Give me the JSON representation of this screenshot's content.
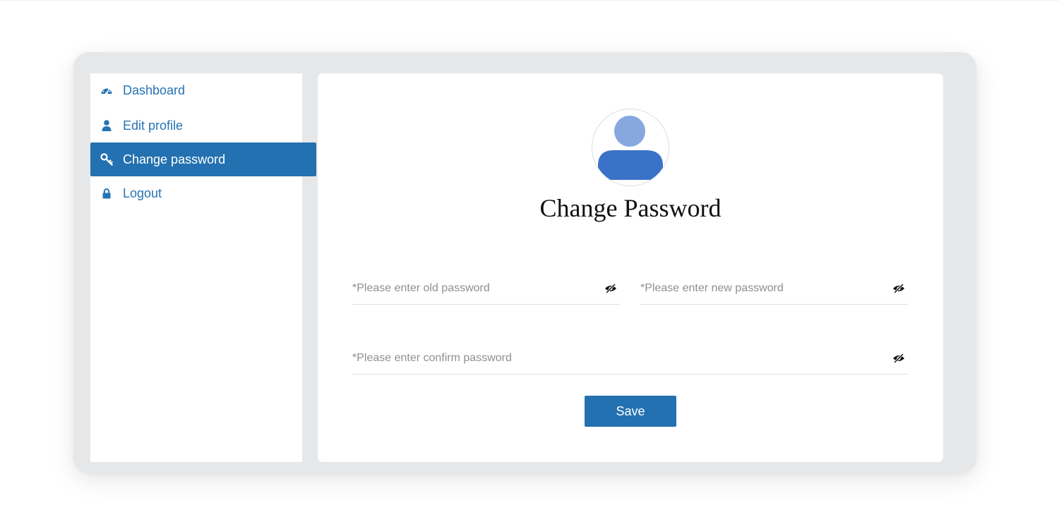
{
  "sidebar": {
    "items": [
      {
        "label": "Dashboard",
        "icon": "dashboard-icon",
        "active": false
      },
      {
        "label": "Edit profile",
        "icon": "user-icon",
        "active": false
      },
      {
        "label": "Change password",
        "icon": "key-icon",
        "active": true
      },
      {
        "label": "Logout",
        "icon": "lock-icon",
        "active": false
      }
    ]
  },
  "main": {
    "title": "Change Password",
    "fields": {
      "old_password": {
        "value": "",
        "placeholder": "*Please enter old password"
      },
      "new_password": {
        "value": "",
        "placeholder": "*Please enter new password"
      },
      "confirm_password": {
        "value": "",
        "placeholder": "*Please enter confirm password"
      }
    },
    "save_label": "Save"
  },
  "colors": {
    "accent": "#2371b0",
    "link": "#2673b4",
    "avatar_head": "#86a8df",
    "avatar_body": "#3a72c8",
    "background_card": "#e6e7e8"
  }
}
